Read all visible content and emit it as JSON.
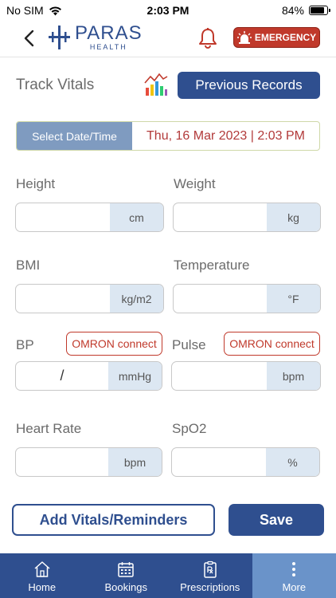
{
  "status_bar": {
    "carrier": "No SIM",
    "time": "2:03 PM",
    "battery": "84%",
    "battery_level": 0.84
  },
  "header": {
    "logo_name": "PARAS",
    "logo_sub": "HEALTH",
    "emergency_label": "EMERGENCY"
  },
  "track": {
    "title": "Track Vitals",
    "previous_records_label": "Previous Records"
  },
  "date_time": {
    "label": "Select Date/Time",
    "value": "Thu, 16 Mar 2023 | 2:03 PM"
  },
  "fields": {
    "height": {
      "label": "Height",
      "unit": "cm",
      "value": ""
    },
    "weight": {
      "label": "Weight",
      "unit": "kg",
      "value": ""
    },
    "bmi": {
      "label": "BMI",
      "unit": "kg/m2",
      "value": ""
    },
    "temperature": {
      "label": "Temperature",
      "unit": "°F",
      "value": ""
    },
    "bp": {
      "label": "BP",
      "unit": "mmHg",
      "separator": "/",
      "omron_label": "OMRON connect"
    },
    "pulse": {
      "label": "Pulse",
      "unit": "bpm",
      "omron_label": "OMRON connect"
    },
    "heart_rate": {
      "label": "Heart Rate",
      "unit": "bpm",
      "value": ""
    },
    "spo2": {
      "label": "SpO2",
      "unit": "%",
      "value": ""
    }
  },
  "actions": {
    "add_label": "Add Vitals/Reminders",
    "save_label": "Save"
  },
  "nav": {
    "items": [
      {
        "label": "Home",
        "icon": "home-icon"
      },
      {
        "label": "Bookings",
        "icon": "calendar-icon"
      },
      {
        "label": "Prescriptions",
        "icon": "prescription-icon"
      },
      {
        "label": "More",
        "icon": "more-icon"
      }
    ],
    "active_index": 3
  },
  "colors": {
    "primary": "#2f4f8f",
    "emergency": "#c0392b",
    "nav_active": "#6a93c9",
    "date_label_bg": "#7f9bc0",
    "unit_bg": "#dce7f2"
  }
}
